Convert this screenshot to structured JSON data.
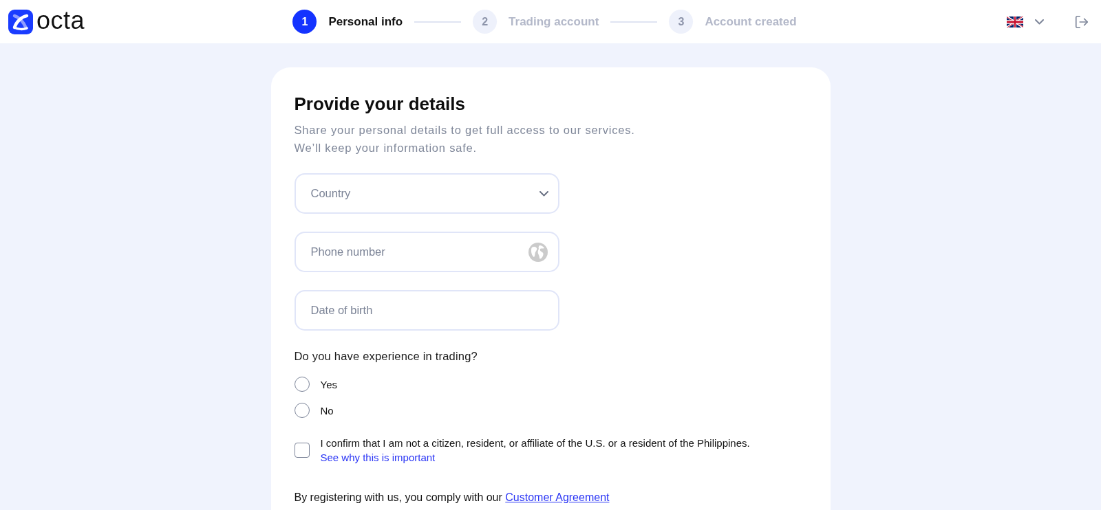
{
  "header": {
    "logo": "octa",
    "steps": [
      {
        "number": "1",
        "label": "Personal info",
        "selected": true
      },
      {
        "number": "2",
        "label": "Trading account",
        "selected": false
      },
      {
        "number": "3",
        "label": "Account created",
        "selected": false
      }
    ]
  },
  "form": {
    "title": "Provide your details",
    "subtitle": [
      "Share your personal details to get full access to our services.",
      "We’ll keep your information safe."
    ],
    "fields": [
      {
        "kind": "select",
        "placeholder": "Country"
      },
      {
        "kind": "phone",
        "placeholder": "Phone number"
      },
      {
        "kind": "date",
        "placeholder": "Date of birth"
      }
    ],
    "experience": {
      "question": "Do you have experience in trading?",
      "options": [
        {
          "label": "Yes",
          "selected": false
        },
        {
          "label": "No",
          "selected": false
        }
      ]
    },
    "confirmation": {
      "checked": false,
      "text": "I confirm that I am not a citizen, resident, or affiliate of the U.S. or a resident of the Philippines.",
      "link": "See why this is important"
    },
    "agreement": {
      "text": "By registering with us, you comply with our",
      "link": "Customer Agreement"
    }
  }
}
